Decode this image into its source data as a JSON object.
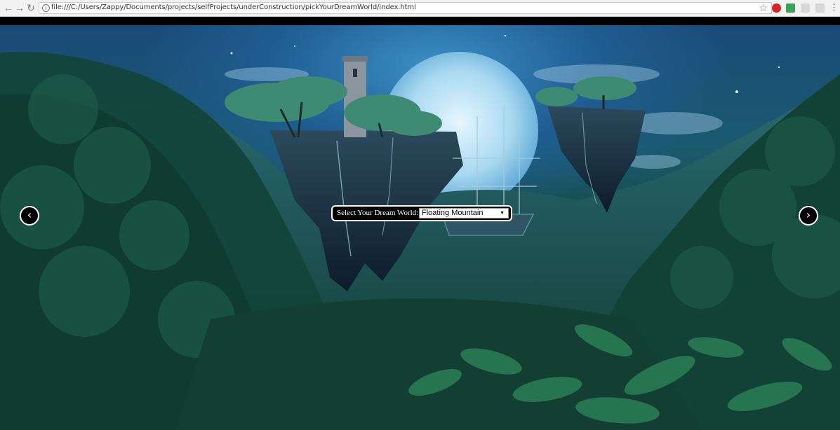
{
  "browser": {
    "url": "file:///C:/Users/Zappy/Documents/projects/selfProjects/underConstruction/pickYourDreamWorld/index.html",
    "back_icon": "arrow-left-icon",
    "forward_icon": "arrow-right-icon",
    "reload_icon": "reload-icon",
    "bookmark_icon": "star-icon",
    "extensions": [
      "adblock-icon",
      "extension-green-icon",
      "extension-gray-icon",
      "extension-gray-icon"
    ],
    "menu_icon": "kebab-menu-icon"
  },
  "selector": {
    "label": "Select Your Dream World:",
    "selected_value": "Floating Mountain"
  },
  "carousel": {
    "prev_glyph": "‹",
    "next_glyph": "›"
  },
  "colors": {
    "sky": "#1f5d92",
    "moon": "#bfe2f5",
    "forest": "#17463f",
    "selector_bg": "#000000",
    "selector_border": "#ffffff"
  }
}
